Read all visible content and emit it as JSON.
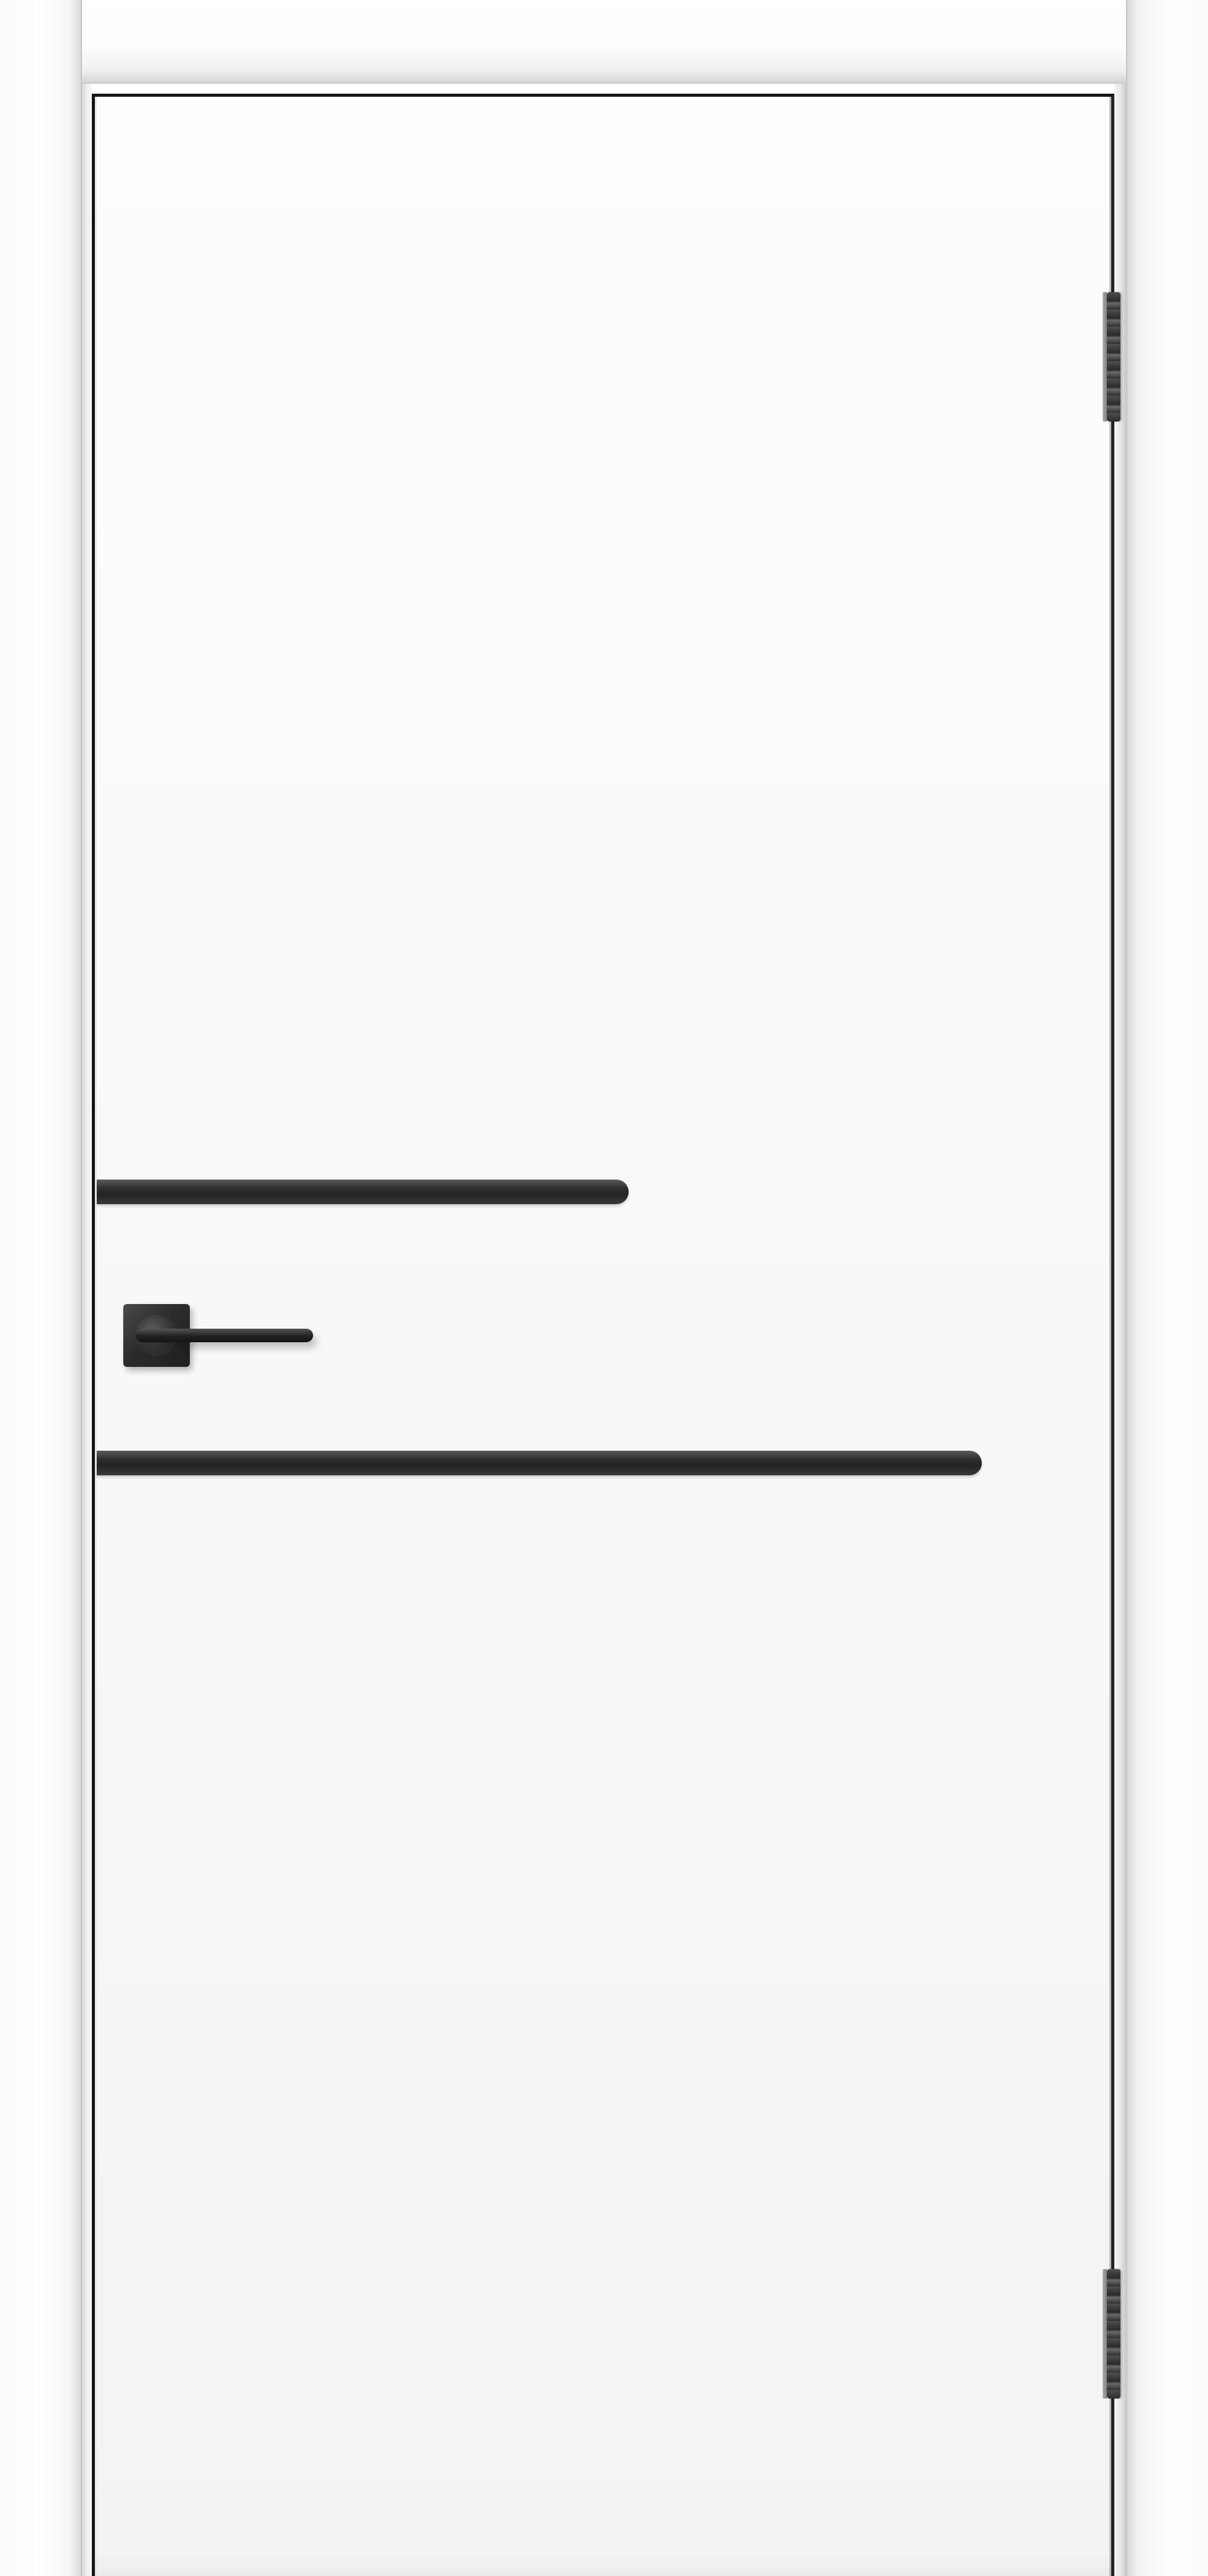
{
  "scene": {
    "subject": "door-image",
    "colors": {
      "door_leaf": "#fafaf9",
      "frame": "#ffffff",
      "edge": "#161616",
      "groove": "#2f2f2f",
      "hardware": "#2b2b2b"
    }
  },
  "icons": {
    "handle": "door-handle-icon",
    "hinge": "hinge-icon"
  }
}
